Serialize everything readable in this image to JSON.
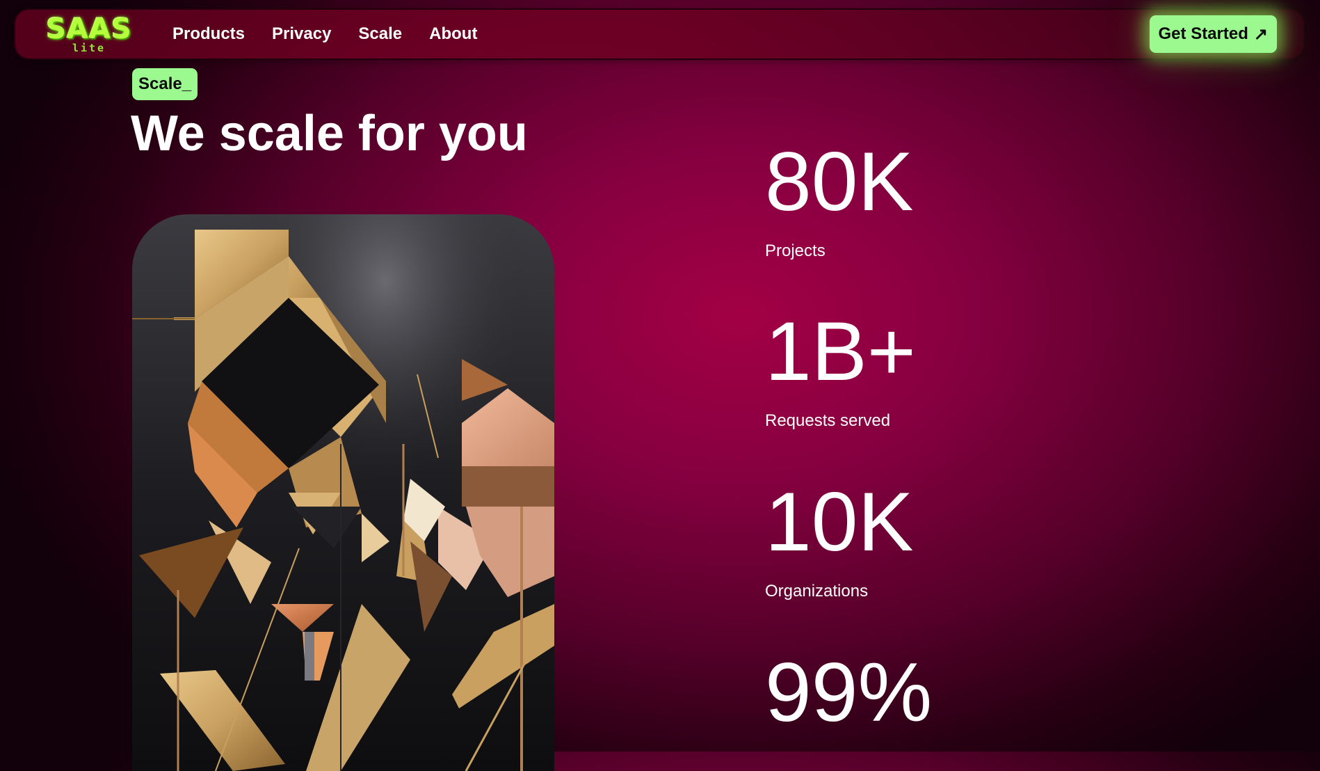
{
  "nav": {
    "logo_text": "SAAS",
    "logo_sub": "lite",
    "links": [
      "Products",
      "Privacy",
      "Scale",
      "About"
    ],
    "cta_label": "Get Started",
    "cta_icon": "↗"
  },
  "hero": {
    "tag": "Scale_",
    "headline": "We scale for you"
  },
  "stats": [
    {
      "value": "80K",
      "label": "Projects"
    },
    {
      "value": "1B+",
      "label": "Requests served"
    },
    {
      "value": "10K",
      "label": "Organizations"
    },
    {
      "value": "99%",
      "label": ""
    }
  ],
  "colors": {
    "accent_green": "#9bf98f",
    "background": "#860040",
    "logo_green": "#b6ff3d"
  },
  "icons": {
    "cta_arrow": "arrow-up-right-icon"
  }
}
